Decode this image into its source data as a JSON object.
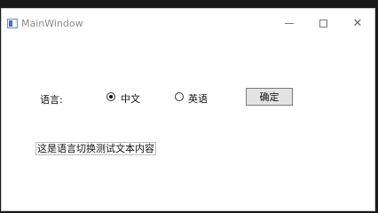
{
  "window": {
    "title": "MainWindow"
  },
  "controls": {
    "language_label": "语言:",
    "radio_options": [
      {
        "label": "中文",
        "checked": true
      },
      {
        "label": "英语",
        "checked": false
      }
    ],
    "confirm_label": "确定"
  },
  "content": {
    "text": "这是语言切换测试文本内容"
  }
}
